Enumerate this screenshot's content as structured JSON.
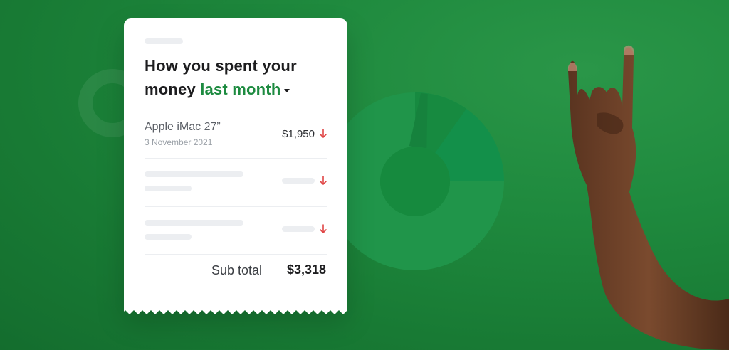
{
  "card": {
    "title_line1": "How you spent your",
    "title_line2_prefix": "money ",
    "title_period": "last month",
    "item": {
      "name": "Apple iMac 27”",
      "date": "3 November 2021",
      "amount": "$1,950"
    },
    "subtotal_label": "Sub total",
    "subtotal_value": "$3,318"
  },
  "colors": {
    "background": "#1f8a3e",
    "accent": "#1d8b40",
    "expense_arrow": "#e04646"
  },
  "icons": {
    "expense_arrow": "arrow-down-icon",
    "dropdown": "caret-down-icon"
  }
}
